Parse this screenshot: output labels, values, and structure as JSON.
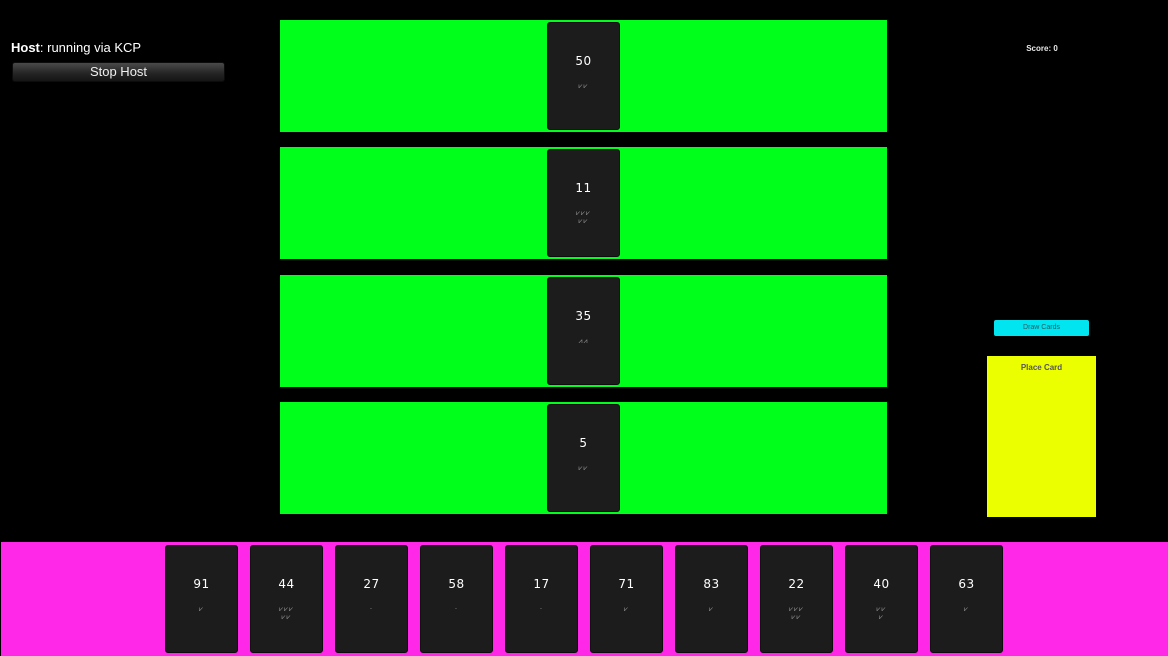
{
  "host": {
    "label": "Host",
    "status": ": running via KCP",
    "stop_label": "Stop Host"
  },
  "score": "Score: 0",
  "draw_label": "Draw Cards",
  "place_label": "Place Card",
  "rows": [
    {
      "value": "50",
      "bulls": "⩗⩗"
    },
    {
      "value": "11",
      "bulls": "⩗⩗⩗\n⩗⩗"
    },
    {
      "value": "35",
      "bulls": "⩘⩘"
    },
    {
      "value": "5",
      "bulls": "⩗⩗"
    }
  ],
  "hand": [
    {
      "value": "91",
      "bulls": "⩗"
    },
    {
      "value": "44",
      "bulls": "⩗⩗⩗\n⩗⩗"
    },
    {
      "value": "27",
      "bulls": "·"
    },
    {
      "value": "58",
      "bulls": "·"
    },
    {
      "value": "17",
      "bulls": "·"
    },
    {
      "value": "71",
      "bulls": "⩗"
    },
    {
      "value": "83",
      "bulls": "⩗"
    },
    {
      "value": "22",
      "bulls": "⩗⩗⩗\n⩗⩗"
    },
    {
      "value": "40",
      "bulls": "⩗⩗\n⩗"
    },
    {
      "value": "63",
      "bulls": "⩗"
    }
  ],
  "colors": {
    "row": "#00ff1b",
    "hand": "#ff28e8",
    "place_zone": "#ecff00",
    "draw_button": "#00e5f0",
    "card": "#1c1c1c"
  }
}
